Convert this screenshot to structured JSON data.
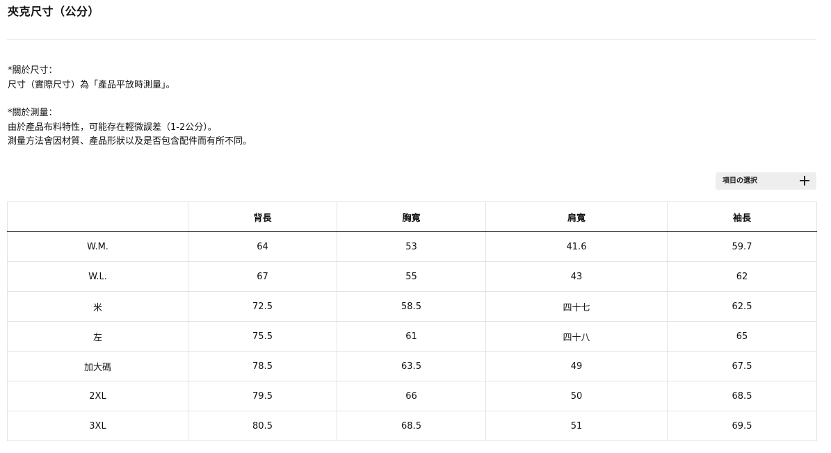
{
  "title": "夾克尺寸（公分）",
  "notes": {
    "size_heading": "*關於尺寸：",
    "size_text": "尺寸（實際尺寸）為「產品平放時測量」。",
    "measure_heading": "*關於測量：",
    "measure_text_1": "由於產品布料特性，可能存在輕微誤差（1-2公分）。",
    "measure_text_2": "測量方法會因材質、產品形狀以及是否包含配件而有所不同。"
  },
  "select_button": {
    "label": "項目の選択",
    "icon": "plus-icon"
  },
  "table": {
    "headers": [
      "",
      "背長",
      "胸寬",
      "肩寬",
      "袖長"
    ],
    "rows": [
      [
        "W.M.",
        "64",
        "53",
        "41.6",
        "59.7"
      ],
      [
        "W.L.",
        "67",
        "55",
        "43",
        "62"
      ],
      [
        "米",
        "72.5",
        "58.5",
        "四十七",
        "62.5"
      ],
      [
        "左",
        "75.5",
        "61",
        "四十八",
        "65"
      ],
      [
        "加大碼",
        "78.5",
        "63.5",
        "49",
        "67.5"
      ],
      [
        "2XL",
        "79.5",
        "66",
        "50",
        "68.5"
      ],
      [
        "3XL",
        "80.5",
        "68.5",
        "51",
        "69.5"
      ]
    ]
  }
}
